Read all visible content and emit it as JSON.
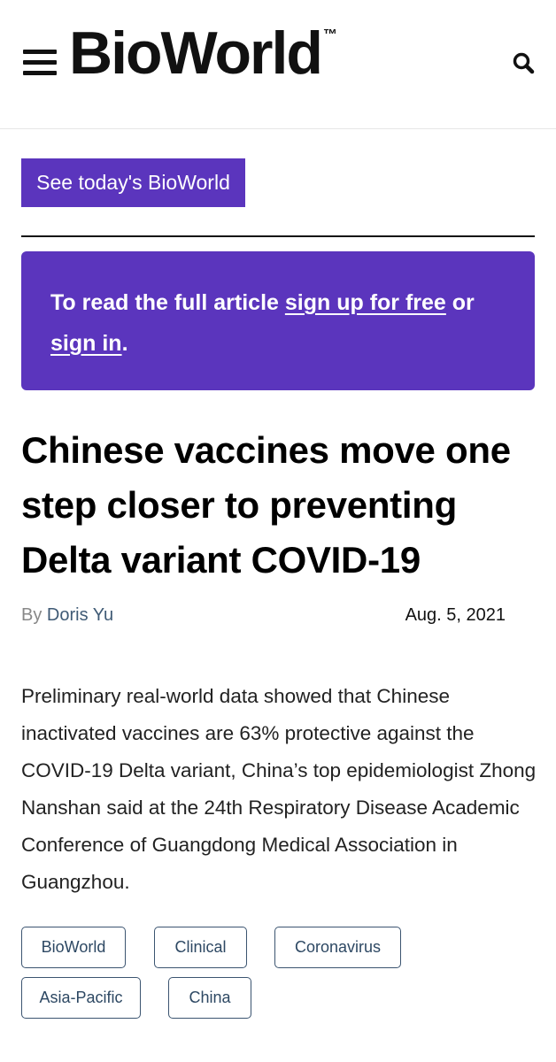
{
  "header": {
    "logo_text": "BioWorld",
    "logo_mark": "™",
    "menu_icon": "hamburger-menu-icon",
    "search_icon": "search-icon"
  },
  "today_button": {
    "label": "See today's BioWorld"
  },
  "paywall": {
    "prefix": "To read the full article ",
    "signup_link": "sign up for free",
    "middle": " or",
    "signin_link": "sign in",
    "suffix": "."
  },
  "article": {
    "headline": "Chinese vaccines move one step closer to preventing Delta variant COVID-19",
    "by_label": "By",
    "author": "Doris Yu",
    "date": "Aug. 5, 2021",
    "body": "Preliminary real-world data showed that Chinese inactivated vaccines are 63% protective against the COVID-19 Delta variant, China’s top epidemiologist Zhong Nanshan said at the 24th Respiratory Disease Academic Conference of Guangdong Medical Association in Guangzhou."
  },
  "tags": [
    "BioWorld",
    "Clinical",
    "Coronavirus",
    "Asia-Pacific",
    "China"
  ],
  "colors": {
    "brand_purple": "#5b35bd",
    "tag_border": "#3b5470",
    "author_link": "#3f5a75"
  }
}
